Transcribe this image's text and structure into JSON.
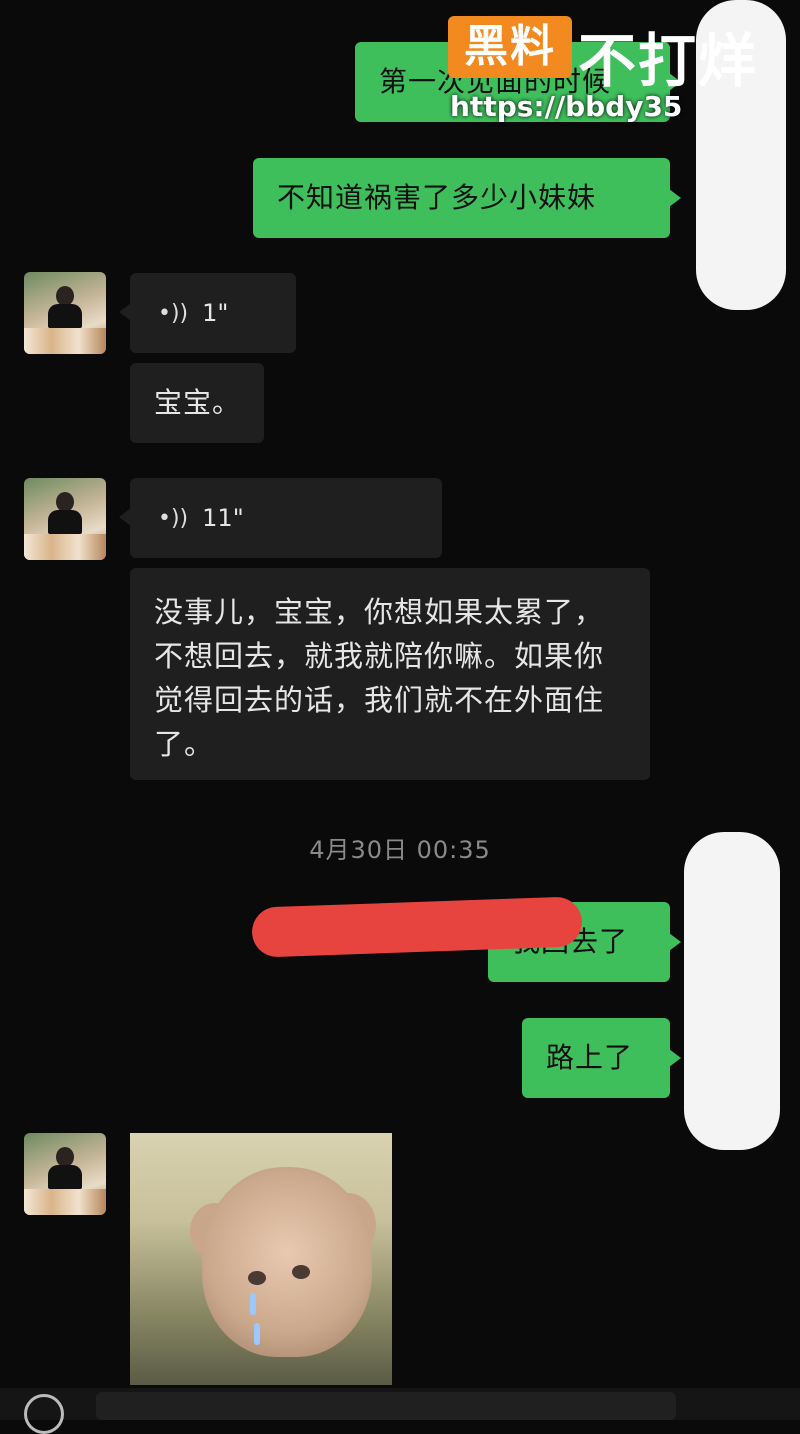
{
  "watermark": {
    "box_text": "黑料",
    "text": "不打烊",
    "url": "https://bbdy35"
  },
  "messages": [
    {
      "side": "right",
      "text": "第一次见面的时候"
    },
    {
      "side": "right",
      "text": "不知道祸害了多少小妹妹"
    },
    {
      "side": "left",
      "type": "voice",
      "duration": "1\""
    },
    {
      "side": "left",
      "text": "宝宝。"
    },
    {
      "side": "left",
      "type": "voice",
      "duration": "11\""
    },
    {
      "side": "left",
      "text": "没事儿，宝宝，你想如果太累了，不想回去，就我就陪你嘛。如果你觉得回去的话，我们就不在外面住了。"
    },
    {
      "side": "right",
      "text": "我回去了"
    },
    {
      "side": "right",
      "text": "路上了"
    },
    {
      "side": "left",
      "type": "image",
      "image": "crying-dog-photo"
    }
  ],
  "timestamp": "4月30日 00:35",
  "colors": {
    "background": "#0a0a0a",
    "sent_bubble": "#3fbf5c",
    "received_bubble": "#1f1f1f",
    "watermark_orange": "#f28a1f",
    "scribble_red": "#e8443f"
  }
}
